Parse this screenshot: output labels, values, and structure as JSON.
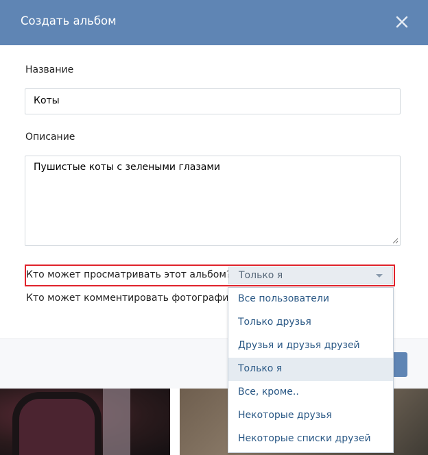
{
  "dialog": {
    "title": "Создать альбом"
  },
  "form": {
    "name_label": "Название",
    "name_value": "Коты",
    "description_label": "Описание",
    "description_value": "Пушистые коты с зелеными глазами",
    "view_privacy_label": "Кто может просматривать этот альбом?",
    "comment_privacy_label": "Кто может комментировать фотографии?",
    "view_privacy_selected": "Только я"
  },
  "dropdown": {
    "options": [
      "Все пользователи",
      "Только друзья",
      "Друзья и друзья друзей",
      "Только я",
      "Все, кроме..",
      "Некоторые друзья",
      "Некоторые списки друзей"
    ],
    "active_index": 3
  },
  "colors": {
    "header": "#5f85b4",
    "highlight_border": "#e0222b",
    "link": "#2a5885"
  }
}
